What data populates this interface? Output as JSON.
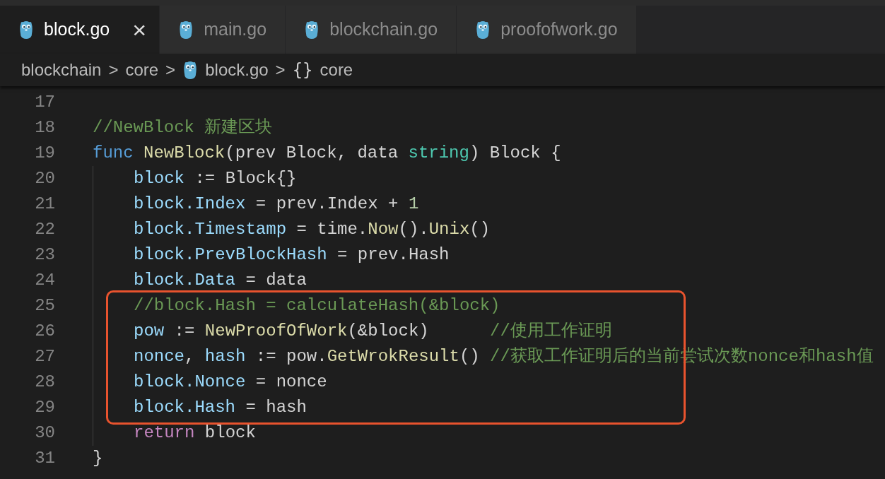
{
  "tabs": [
    {
      "label": "block.go",
      "selected": true,
      "close_glyph": "×"
    },
    {
      "label": "main.go",
      "selected": false
    },
    {
      "label": "blockchain.go",
      "selected": false
    },
    {
      "label": "proofofwork.go",
      "selected": false
    }
  ],
  "breadcrumb": [
    {
      "text": "blockchain",
      "kind": "folder",
      "separator": ">"
    },
    {
      "text": "core",
      "kind": "folder",
      "separator": ">"
    },
    {
      "text": "block.go",
      "kind": "file",
      "separator": ">"
    },
    {
      "text": "core",
      "kind": "symbol",
      "symbol": "{}"
    }
  ],
  "code": [
    {
      "kind": "line",
      "number": "17",
      "indented": false
    },
    {
      "kind": "line",
      "number": "18",
      "indented": false,
      "tokens": [
        {
          "text": "//NewBlock 新建区块",
          "kind": "comment"
        }
      ]
    },
    {
      "kind": "line",
      "number": "19",
      "indented": false,
      "tokens": [
        {
          "text": "func",
          "kind": "keyword"
        },
        {
          "text": " NewBlock",
          "kind": "function"
        },
        {
          "text": "(prev Block, data ",
          "kind": "plain"
        },
        {
          "text": "string",
          "kind": "type"
        },
        {
          "text": ") Block {",
          "kind": "plain"
        }
      ]
    },
    {
      "kind": "line",
      "number": "20",
      "indented": true,
      "tokens": [
        {
          "text": "block",
          "kind": "variable"
        },
        {
          "text": " := Block{}",
          "kind": "plain"
        }
      ]
    },
    {
      "kind": "line",
      "number": "21",
      "indented": true,
      "tokens": [
        {
          "text": "block.Index",
          "kind": "variable"
        },
        {
          "text": " = prev.Index + ",
          "kind": "plain"
        },
        {
          "text": "1",
          "kind": "number"
        }
      ]
    },
    {
      "kind": "line",
      "number": "22",
      "indented": true,
      "tokens": [
        {
          "text": "block.Timestamp",
          "kind": "variable"
        },
        {
          "text": " = time.",
          "kind": "plain"
        },
        {
          "text": "Now",
          "kind": "function"
        },
        {
          "text": "().",
          "kind": "plain"
        },
        {
          "text": "Unix",
          "kind": "function"
        },
        {
          "text": "()",
          "kind": "plain"
        }
      ]
    },
    {
      "kind": "line",
      "number": "23",
      "indented": true,
      "tokens": [
        {
          "text": "block.PrevBlockHash",
          "kind": "variable"
        },
        {
          "text": " = prev.Hash",
          "kind": "plain"
        }
      ]
    },
    {
      "kind": "line",
      "number": "24",
      "indented": true,
      "tokens": [
        {
          "text": "block.Data",
          "kind": "variable"
        },
        {
          "text": " = data",
          "kind": "plain"
        }
      ]
    },
    {
      "kind": "highlight_frame",
      "lines": [
        {
          "number": "25",
          "indented": true,
          "tokens": [
            {
              "text": "//block.Hash = calculateHash(&block)",
              "kind": "comment"
            }
          ]
        },
        {
          "number": "26",
          "indented": true,
          "tokens": [
            {
              "text": "pow",
              "kind": "variable"
            },
            {
              "text": " := ",
              "kind": "plain"
            },
            {
              "text": "NewProofOfWork",
              "kind": "function"
            },
            {
              "text": "(&block)      ",
              "kind": "plain"
            },
            {
              "text": "//使用工作证明",
              "kind": "comment"
            }
          ]
        },
        {
          "number": "27",
          "indented": true,
          "tokens": [
            {
              "text": "nonce",
              "kind": "variable"
            },
            {
              "text": ", ",
              "kind": "plain"
            },
            {
              "text": "hash",
              "kind": "variable"
            },
            {
              "text": " := pow.",
              "kind": "plain"
            },
            {
              "text": "GetWrokResult",
              "kind": "function"
            },
            {
              "text": "() ",
              "kind": "plain"
            },
            {
              "text": "//获取工作证明后的当前尝试次数nonce和hash值",
              "kind": "comment"
            }
          ]
        },
        {
          "number": "28",
          "indented": true,
          "tokens": [
            {
              "text": "block.Nonce",
              "kind": "variable"
            },
            {
              "text": " = nonce",
              "kind": "plain"
            }
          ]
        },
        {
          "number": "29",
          "indented": true,
          "tokens": [
            {
              "text": "block.Hash",
              "kind": "variable"
            },
            {
              "text": " = hash",
              "kind": "plain"
            }
          ]
        }
      ]
    },
    {
      "kind": "line",
      "number": "30",
      "indented": true,
      "tokens": [
        {
          "text": "return",
          "kind": "control"
        },
        {
          "text": " block",
          "kind": "plain"
        }
      ]
    },
    {
      "kind": "line",
      "number": "31",
      "indented": false,
      "tokens": [
        {
          "text": "}",
          "kind": "plain"
        }
      ]
    }
  ]
}
